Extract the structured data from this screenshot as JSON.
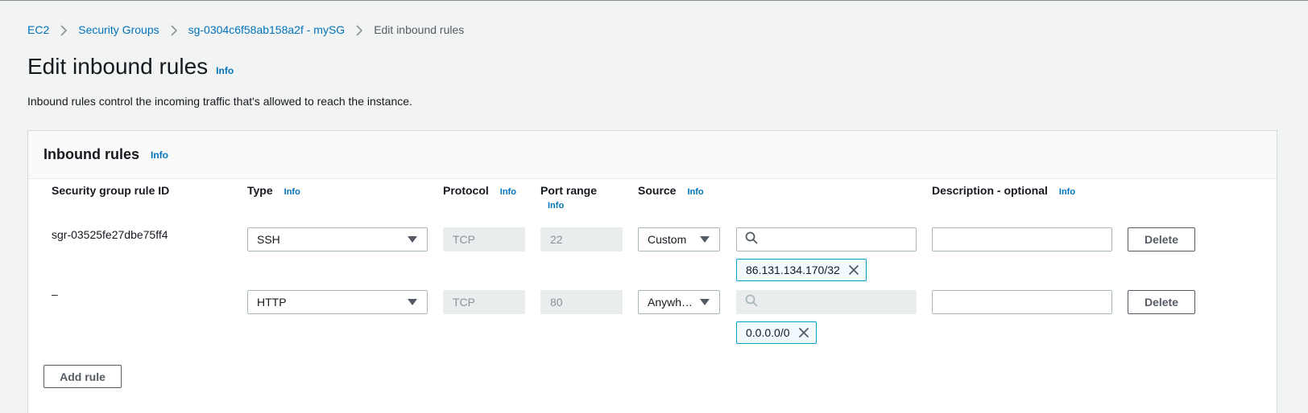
{
  "breadcrumb": {
    "items": [
      "EC2",
      "Security Groups",
      "sg-0304c6f58ab158a2f - mySG"
    ],
    "current": "Edit inbound rules"
  },
  "page": {
    "title": "Edit inbound rules",
    "info": "Info",
    "description": "Inbound rules control the incoming traffic that's allowed to reach the instance."
  },
  "panel": {
    "title": "Inbound rules",
    "info": "Info",
    "columns": {
      "rule_id": "Security group rule ID",
      "type": "Type",
      "protocol": "Protocol",
      "port_range": "Port range",
      "source": "Source",
      "description": "Description - optional",
      "info": "Info"
    },
    "rows": [
      {
        "rule_id": "sgr-03525fe27dbe75ff4",
        "type": "SSH",
        "protocol": "TCP",
        "port": "22",
        "source": "Custom",
        "token": "86.131.134.170/32",
        "delete": "Delete"
      },
      {
        "rule_id": "–",
        "type": "HTTP",
        "protocol": "TCP",
        "port": "80",
        "source": "Anywhe…",
        "token": "0.0.0.0/0",
        "delete": "Delete"
      }
    ],
    "add_rule": "Add rule"
  }
}
